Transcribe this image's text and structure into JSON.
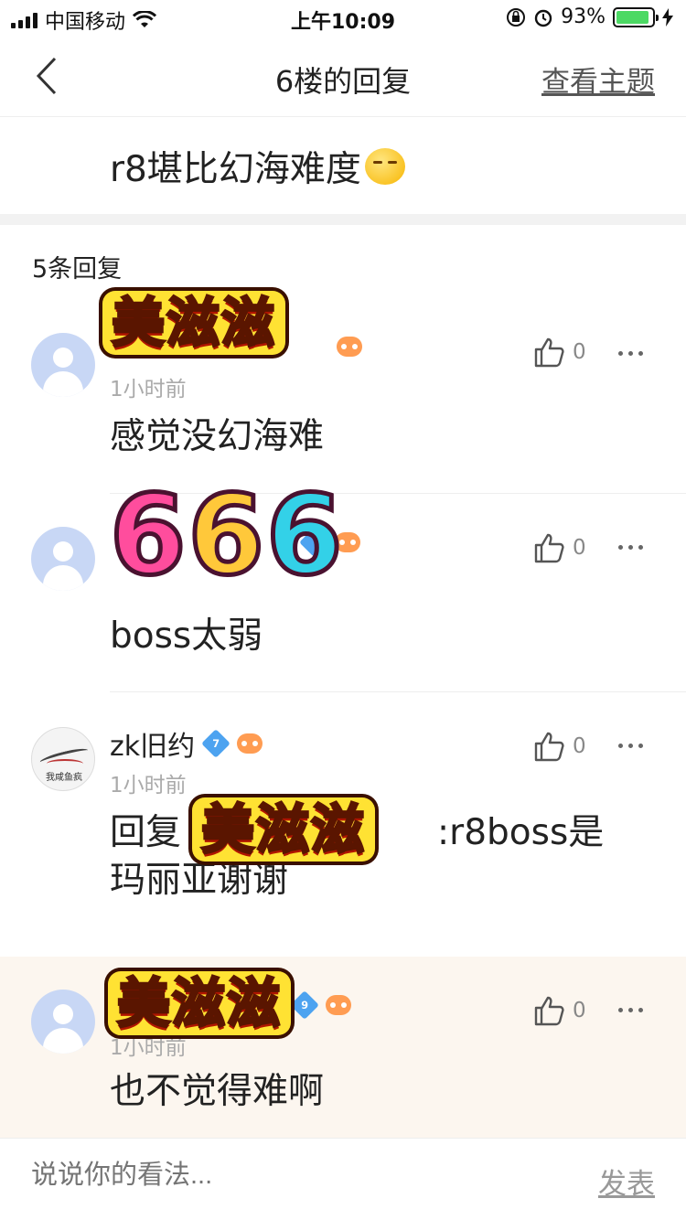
{
  "status_bar": {
    "carrier": "中国移动",
    "time": "上午10:09",
    "battery": "93%",
    "battery_level": 0.93
  },
  "nav": {
    "title": "6楼的回复",
    "view_topic": "查看主题"
  },
  "main_post": {
    "text": "r8堪比幻海难度"
  },
  "reply_count": "5条回复",
  "replies": [
    {
      "username": "",
      "time": "1小时前",
      "content": "感觉没幻海难",
      "likes": "0",
      "badge_level": ""
    },
    {
      "username": "",
      "time": "",
      "content": "boss太弱",
      "likes": "0",
      "badge_level": ""
    },
    {
      "username": "zk旧约",
      "time": "1小时前",
      "content": "回复",
      "content_tail": ":r8boss是",
      "content_line2": "玛丽亚谢谢",
      "likes": "0",
      "badge_level": "7",
      "avatar_caption": "我咸鱼疯"
    },
    {
      "username": "",
      "time": "1小时前",
      "content": "也不觉得难啊",
      "likes": "0",
      "badge_level": "9"
    }
  ],
  "stickers": {
    "meizizi": "美滋滋",
    "six": "666"
  },
  "comment": {
    "placeholder": "说说你的看法...",
    "send": "发表"
  },
  "colors": {
    "avatar_default": "#c8d7f5",
    "highlight_row": "#fcf6ef",
    "battery": "#4cd964"
  }
}
